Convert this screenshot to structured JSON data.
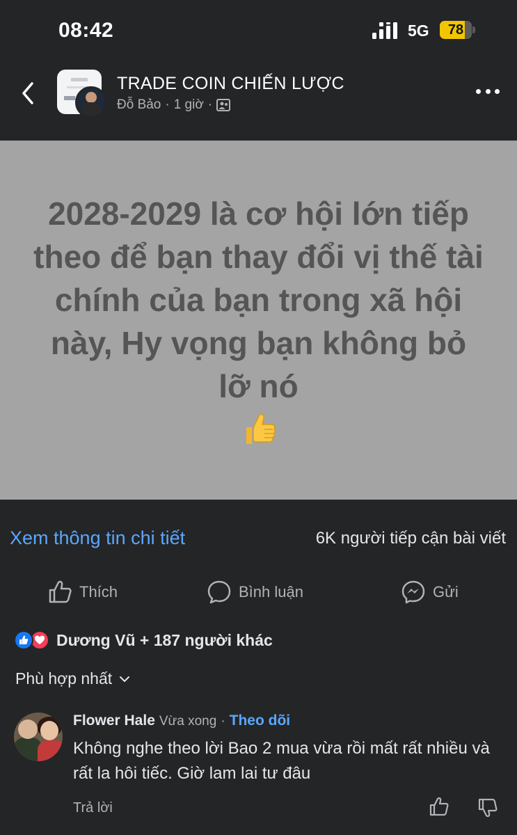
{
  "status_bar": {
    "time": "08:42",
    "network": "5G",
    "battery": "78",
    "battery_level": 0.78
  },
  "header": {
    "group_name": "TRADE COIN CHIẾN LƯỢC",
    "author": "Đỗ Bảo",
    "time": "1 giờ",
    "separator": "·"
  },
  "post": {
    "text": "2028-2029 là cơ hội lớn tiếp theo để bạn thay đổi vị thế tài chính của bạn trong xã hội này, Hy vọng bạn không bỏ lỡ nó",
    "background": "#a4a4a4",
    "text_color": "#555555",
    "emoji": "thumbs-up"
  },
  "insights": {
    "see_more": "Xem thông tin chi tiết",
    "reach": "6K người tiếp cận bài viết"
  },
  "actions": {
    "like": "Thích",
    "comment": "Bình luận",
    "send": "Gửi"
  },
  "reactions": {
    "summary": "Dương Vũ + 187 người khác",
    "icons": [
      "like",
      "love"
    ]
  },
  "sort": {
    "label": "Phù hợp nhất"
  },
  "comment": {
    "name": "Flower Hale",
    "time": "Vừa xong",
    "separator": "·",
    "follow": "Theo dõi",
    "text": "Không nghe theo lời Bao 2 mua vừa rồi mất rất nhiều và rất la hôi tiếc.  Giờ lam lai tư đâu",
    "reply": "Trả lời"
  },
  "colors": {
    "background": "#242526",
    "link": "#5aa7ff",
    "like_blue": "#1877f2",
    "love_red": "#f33e58",
    "battery_yellow": "#f2c500"
  }
}
